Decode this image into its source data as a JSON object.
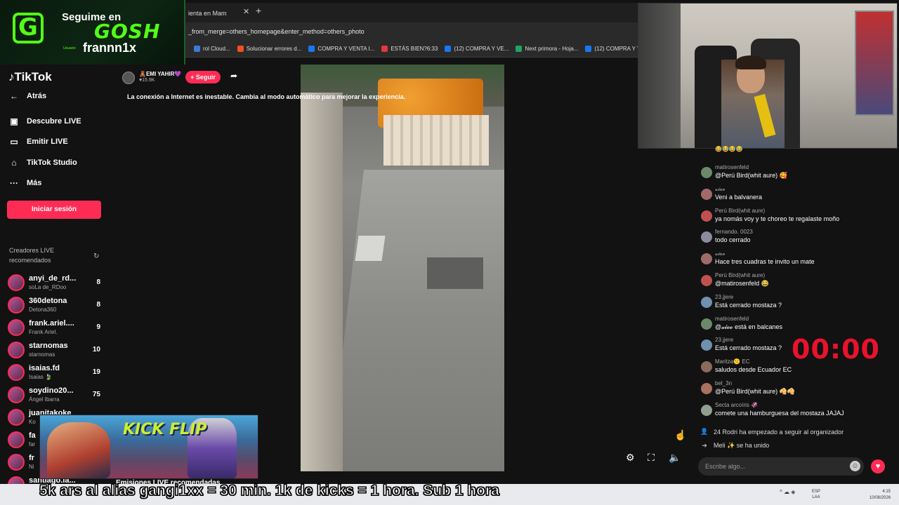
{
  "browser": {
    "tab_title": "ienta en Mam",
    "tab_close": "✕",
    "tab_new": "+",
    "url": "_from_merge=others_homepage&enter_method=others_photo",
    "bookmarks": [
      {
        "label": "rol Cloud...",
        "color": "#3a7bd5"
      },
      {
        "label": "Solucionar errores d...",
        "color": "#f25022"
      },
      {
        "label": "COMPRA Y VENTA I...",
        "color": "#1877f2"
      },
      {
        "label": "ESTÁS BIEN?6:33",
        "color": "#e03a3a"
      },
      {
        "label": "(12) COMPRA Y VE...",
        "color": "#1877f2"
      },
      {
        "label": "Next primora - Hoja...",
        "color": "#1fa463"
      },
      {
        "label": "(12) COMPRA Y VE...",
        "color": "#1877f2"
      }
    ]
  },
  "overlay": {
    "logo_letter": "G",
    "seguime": "Seguime en",
    "gosh": "GOSH",
    "usuario": "Usuario:",
    "handle": "frannn1x",
    "accent": "#53fc18"
  },
  "sidebar": {
    "logo": "TikTok",
    "nav": [
      {
        "icon": "←",
        "label": "Atrás"
      },
      {
        "icon": "▣",
        "label": "Descubre LIVE"
      },
      {
        "icon": "▭",
        "label": "Emitir LIVE"
      },
      {
        "icon": "⌂",
        "label": "TikTok Studio"
      },
      {
        "icon": "···",
        "label": "Más"
      }
    ],
    "login_button": "Iniciar sesión",
    "creators_heading": "Creadores LIVE recomendados",
    "refresh_icon": "↻",
    "creators": [
      {
        "name": "anyi_de_rd...",
        "sub": "soLa de_RDoo",
        "count": "8"
      },
      {
        "name": "360detona",
        "sub": "Detona360",
        "count": "8"
      },
      {
        "name": "frank.ariel....",
        "sub": "Frank Ariel.",
        "count": "9"
      },
      {
        "name": "starnomas",
        "sub": "starnomas",
        "count": "10"
      },
      {
        "name": "isaias.fd",
        "sub": "Isaias 🍃",
        "count": "19"
      },
      {
        "name": "soydino20...",
        "sub": "Ángel Ibarra",
        "count": "75"
      },
      {
        "name": "juanitakoke",
        "sub": "Ko",
        "count": ""
      },
      {
        "name": "fa",
        "sub": "far",
        "count": ""
      },
      {
        "name": "fr",
        "sub": "Ni",
        "count": ""
      },
      {
        "name": "santiago.la...",
        "sub": "",
        "count": ""
      }
    ],
    "brand": "#fe2c55"
  },
  "live": {
    "host_name": "🧸EMI YAHIR💜",
    "host_views": "♥15.9K",
    "follow_button": "+ Seguir",
    "share_icon": "➦",
    "warning": "La conexión a Internet es inestable. Cambia al modo automático para mejorar la experiencia.",
    "controls": {
      "settings": "⚙",
      "fullscreen": "⛶",
      "volume": "🔈"
    }
  },
  "chat": {
    "messages": [
      {
        "user": "matirosenfeld",
        "text": "@Perú Bird(whit aure) 🥰"
      },
      {
        "user": "𝔁𝓲𝓸𝓸",
        "text": "Veni a balvanera"
      },
      {
        "user": "Perú Bird(whit aure)",
        "text": "ya nomás voy y te choreo te regalaste moño"
      },
      {
        "user": "fernando. 0023",
        "text": "todo cerrado"
      },
      {
        "user": "𝔁𝓲𝓸𝓸",
        "text": "Hace tres cuadras te invito un mate"
      },
      {
        "user": "Perú Bird(whit aure)",
        "text": "@matirosenfeld 😂"
      },
      {
        "user": "23.jjere",
        "text": "Está cerrado mostaza ?"
      },
      {
        "user": "matirosenfeld",
        "text": "@𝔁𝓲𝓸𝓸 está en balcanes"
      },
      {
        "user": "23.jjere",
        "text": "Está cerrado mostaza ?"
      },
      {
        "user": "Maritza🙁 EC",
        "text": "saludos desde Ecuador EC"
      },
      {
        "user": "bel_3n",
        "text": "@Perú Bird(whit aure) 🥠🥠"
      },
      {
        "user": "Secta arcoíris 🦑",
        "text": "comete una hamburguesa del mostaza JAJAJ"
      }
    ],
    "system": [
      {
        "icon": "👤",
        "text": "24 Rodri  ha empezado a seguir al organizador"
      },
      {
        "icon": "➜",
        "text": "Meli ✨  se ha unido"
      }
    ],
    "input_placeholder": "Escribe algo...",
    "emoji_icon": "☺",
    "heart_icon": "♥",
    "timer": "00:00",
    "timer_color": "#e8132b",
    "top_partial": "😂😂😂😂"
  },
  "promo": {
    "title": "KICK FLIP",
    "below": "Emisiones LIVE recomendadas"
  },
  "ticker": "5k ars al alias gangi1xx = 30 min. 1k de kicks = 1 hora. Sub 1 hora",
  "taskbar": {
    "tray": "^  ☁  ◈",
    "lang": "ESP\nLAA",
    "clock": "4:15\n10/08/2026"
  }
}
